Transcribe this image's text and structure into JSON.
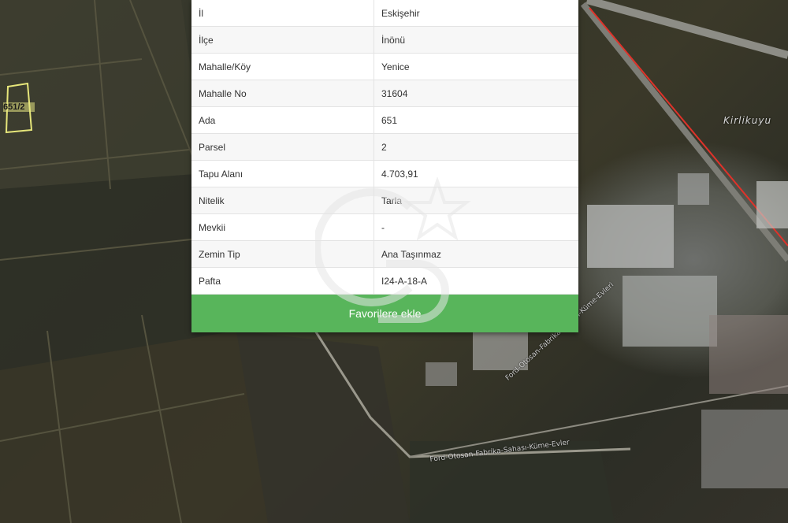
{
  "property_info": {
    "rows": [
      {
        "key": "İl",
        "value": "Eskişehir"
      },
      {
        "key": "İlçe",
        "value": "İnönü"
      },
      {
        "key": "Mahalle/Köy",
        "value": "Yenice"
      },
      {
        "key": "Mahalle No",
        "value": "31604"
      },
      {
        "key": "Ada",
        "value": "651"
      },
      {
        "key": "Parsel",
        "value": "2"
      },
      {
        "key": "Tapu Alanı",
        "value": "4.703,91"
      },
      {
        "key": "Nitelik",
        "value": "Tarla"
      },
      {
        "key": "Mevkii",
        "value": "-"
      },
      {
        "key": "Zemin Tip",
        "value": "Ana Taşınmaz"
      },
      {
        "key": "Pafta",
        "value": "I24-A-18-A"
      }
    ],
    "favorite_button_label": "Favorilere ekle"
  },
  "map": {
    "parcel_label": "651/2",
    "place_label": "Kirlikuyu",
    "road_labels": [
      "Ford-Otosan-Fabrika-Sahası-Küme-Evler",
      "Ford-Otosan-Fabrika-Sahası-Küme-Evleri"
    ],
    "colors": {
      "parcel_outline": "#e6e67a",
      "boundary_line": "#e0322a",
      "button": "#58b55b"
    }
  },
  "watermark": {
    "icon": "gb-star-logo"
  }
}
